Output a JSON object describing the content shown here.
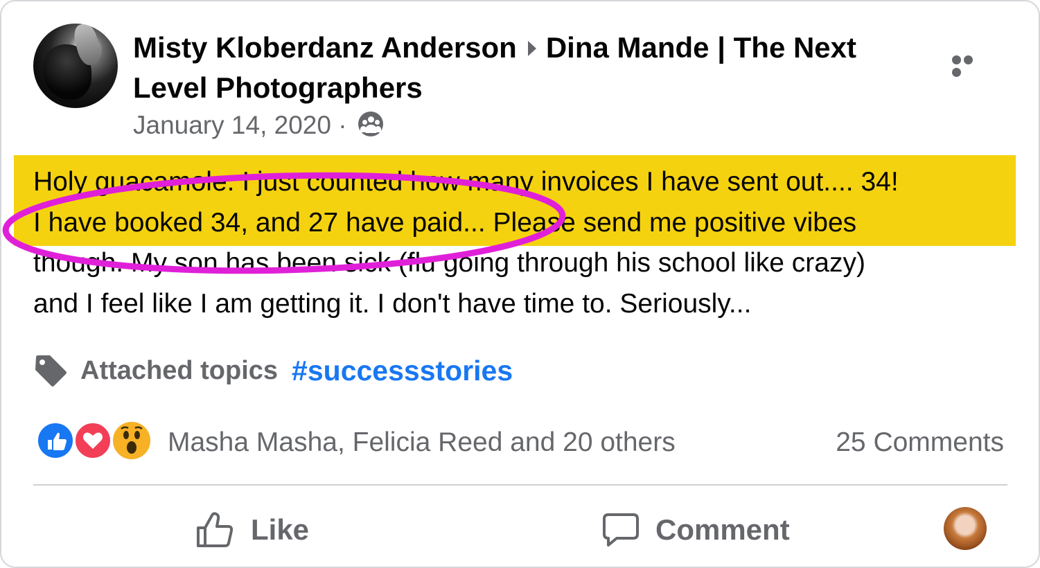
{
  "post": {
    "author": "Misty Kloberdanz Anderson",
    "group": "Dina Mande | The Next Level Photographers",
    "date": "January 14, 2020",
    "separator": "·",
    "audience_icon": "group-icon",
    "more_icon": "more-horizontal-icon",
    "text_lines": [
      "Holy guacamole.  I just counted how many invoices I have sent out.... 34!",
      "I have booked 34, and 27 have paid...  Please send me positive vibes",
      "though.  My son has been sick (flu going through his school like crazy)",
      "and I feel like I am getting it.  I don't have time to.  Seriously..."
    ],
    "highlight_color": "#f5d20f",
    "annotation_color": "#e020d8"
  },
  "topics": {
    "label": "Attached topics",
    "hashtag": "#successstories",
    "icon": "tag-icon"
  },
  "engagement": {
    "reactions": [
      "like",
      "love",
      "wow"
    ],
    "reactors_text": "Masha Masha, Felicia Reed and 20 others",
    "comments_text": "25 Comments"
  },
  "actions": {
    "like_label": "Like",
    "comment_label": "Comment"
  },
  "colors": {
    "text": "#050505",
    "secondary": "#65676b",
    "link": "#1877f2"
  }
}
